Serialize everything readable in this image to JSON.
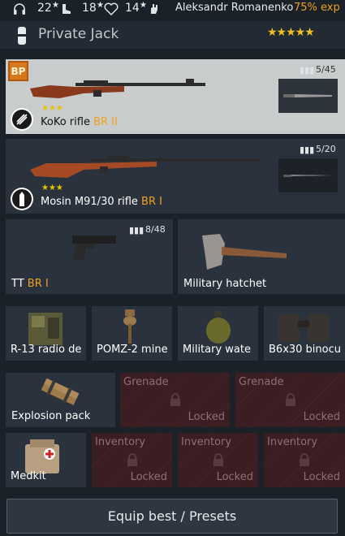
{
  "topbar": {
    "stat1": "22",
    "stat2": "18",
    "stat3": "14",
    "username": "Aleksandr Romanenko",
    "exp": "75% exp"
  },
  "soldier": {
    "rank": "Private Jack",
    "stars": "★★★★★"
  },
  "weapons": {
    "primary": {
      "name": "KoKo rifle",
      "br": "BR II",
      "ammo": "5/45",
      "stars": "★★★",
      "badge": "BP"
    },
    "secondary": {
      "name": "Mosin M91/30 rifle",
      "br": "BR I",
      "ammo": "5/20",
      "stars": "★★★"
    },
    "sidearm": {
      "name": "TT",
      "br": "BR I",
      "ammo": "8/48"
    },
    "melee": {
      "name": "Military hatchet"
    }
  },
  "equipment": [
    {
      "label": "R-13 radio de"
    },
    {
      "label": "POMZ-2 mine"
    },
    {
      "label": "Military wate"
    },
    {
      "label": "B6x30 binocu"
    }
  ],
  "grenades": {
    "explosion": "Explosion pack",
    "slot_title": "Grenade",
    "locked": "Locked"
  },
  "inventory": {
    "medkit": "Medkit",
    "slot_title": "Inventory",
    "locked": "Locked"
  },
  "equip_button": "Equip best / Presets",
  "colors": {
    "accent": "#f0a020",
    "background": "#1a2129",
    "panel": "#2a333d",
    "locked": "#3b1e22"
  }
}
